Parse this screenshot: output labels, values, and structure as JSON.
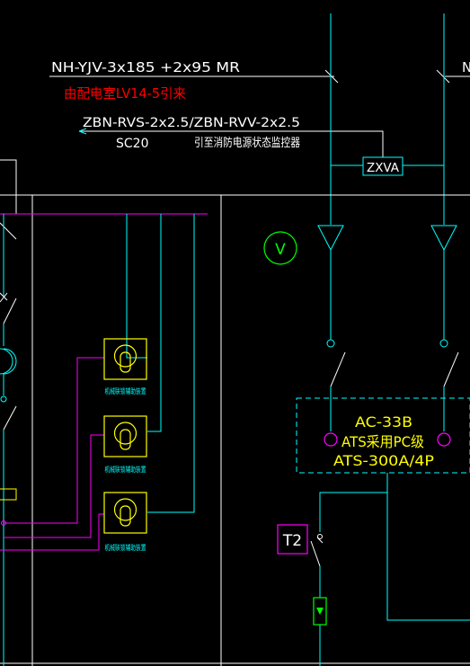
{
  "labels": {
    "cable_main": "NH-YJV-3x185 +2x95  MR",
    "cable_main_cut": "N",
    "source_note": "由配电室LV14-5引来",
    "cable_signal": "ZBN-RVS-2x2.5/ZBN-RVV-2x2.5",
    "conduit": "SC20",
    "monitor_note": "引至消防电源状态监控器",
    "zxva": "ZXVA",
    "voltmeter": "V",
    "ats_model": "AC-33B",
    "ats_type": "ATS采用PC级",
    "ats_rating": "ATS-300A/4P",
    "transformer_tag": "T2",
    "aux_switch_1": "机械联锁辅助装置",
    "aux_switch_2": "机械联锁辅助装置",
    "aux_switch_3": "机械联锁辅助装置"
  },
  "colors": {
    "background": "#000000",
    "line_white": "#ffffff",
    "line_cyan": "#00ffff",
    "line_magenta": "#ff00ff",
    "text_red": "#ff0000",
    "text_yellow": "#ffff00",
    "symbol_green": "#00ff00",
    "wire_light": "#c8f0ff"
  }
}
